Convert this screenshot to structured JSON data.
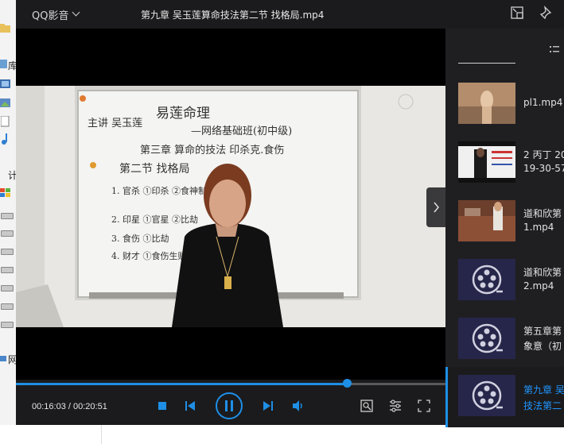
{
  "background_explorer": {
    "labels": [
      "库",
      "计",
      "网"
    ]
  },
  "titlebar": {
    "app_name": "QQ影音",
    "title": "第九章  吴玉莲算命技法第二节 找格局.mp4"
  },
  "video": {
    "whiteboard_lines": [
      "主讲 吴玉莲",
      "易莲命理",
      "—网络基础班(初中级)",
      "第三章  算命的技法  印杀克.食伤",
      "第二节  找格局",
      "1. 官杀 ①印杀 ②食神制杀",
      "2. 印星 ①官星 ②比劫",
      "3. 食伤 ①比劫",
      "4. 财才 ①食伤生财"
    ]
  },
  "player": {
    "time_display": "00:16:03 / 00:20:51",
    "progress": 0.77
  },
  "playlist": {
    "items": [
      {
        "line1": "pl1.mp4",
        "line2": "",
        "thumb": "photo-figure"
      },
      {
        "line1": "2 丙丁 20",
        "line2": "19-30-57",
        "thumb": "photo-class"
      },
      {
        "line1": "道和欣第",
        "line2": "1.mp4",
        "thumb": "photo-stage"
      },
      {
        "line1": "道和欣第",
        "line2": "2.mp4",
        "thumb": "film-reel-icon"
      },
      {
        "line1": "第五章第",
        "line2": "象意（初",
        "thumb": "film-reel-icon"
      },
      {
        "line1": "第九章 吴",
        "line2": "技法第二",
        "thumb": "film-reel-icon",
        "active": true
      }
    ]
  },
  "colors": {
    "accent": "#1e8fe6",
    "player_bg": "#1b1b1d",
    "sidebar_bg": "#1f1f22"
  }
}
